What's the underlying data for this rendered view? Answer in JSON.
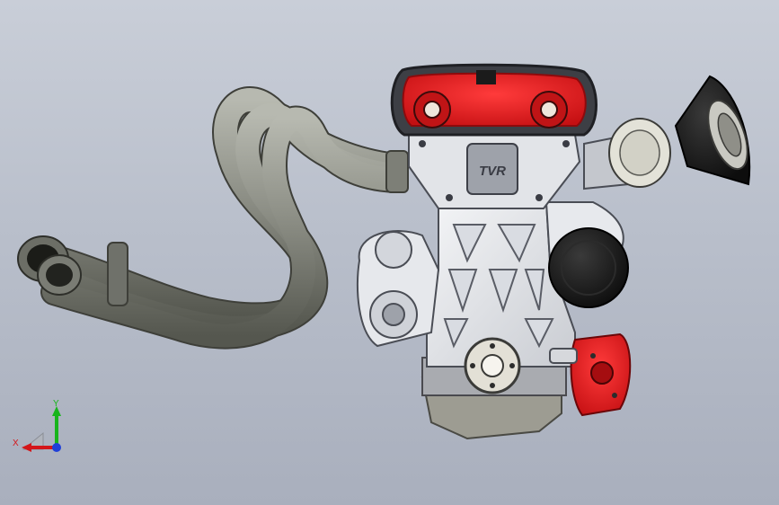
{
  "viewport": {
    "background_top": "#c9ced8",
    "background_bottom": "#a9afbd"
  },
  "model": {
    "cover_logo": "TVR",
    "colors": {
      "cam_cover_red": "#e3191b",
      "block_silver": "#e9ebef",
      "pipe_gray": "#8d8f86",
      "dark_part": "#1b1b1b"
    }
  },
  "triad": {
    "x_label": "X",
    "y_label": "Y",
    "x_color": "#d4161a",
    "y_color": "#18b41c",
    "z_color": "#1f3fd8"
  }
}
